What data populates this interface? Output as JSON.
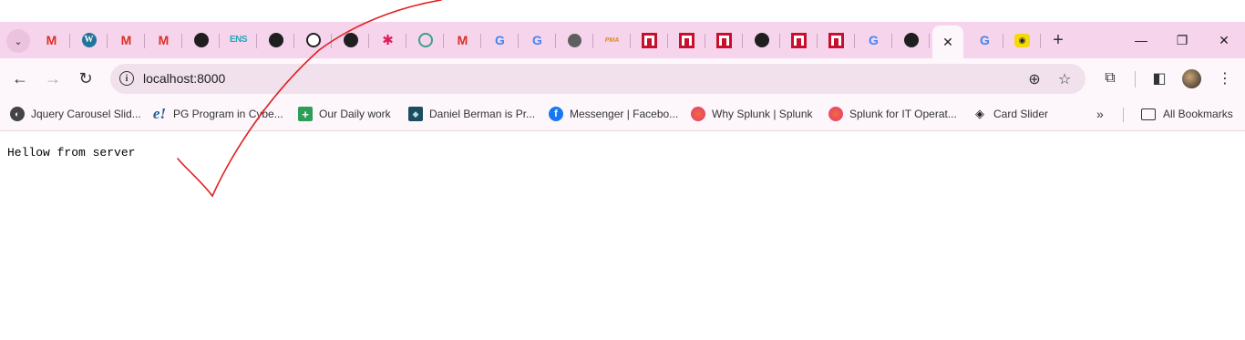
{
  "browser": {
    "tabs": [
      {
        "icon": "gmail-icon",
        "glyph": "M"
      },
      {
        "icon": "wordpress-icon",
        "glyph": "W"
      },
      {
        "icon": "gmail-icon",
        "glyph": "M"
      },
      {
        "icon": "gmail-icon",
        "glyph": "M"
      },
      {
        "icon": "github-icon",
        "glyph": ""
      },
      {
        "icon": "ens-icon",
        "glyph": "ENS"
      },
      {
        "icon": "github-icon",
        "glyph": ""
      },
      {
        "icon": "clock-icon",
        "glyph": ""
      },
      {
        "icon": "github-icon",
        "glyph": ""
      },
      {
        "icon": "slack-icon",
        "glyph": "✱"
      },
      {
        "icon": "chatgpt-icon",
        "glyph": ""
      },
      {
        "icon": "gmail-icon",
        "glyph": "M"
      },
      {
        "icon": "google-icon",
        "glyph": "G"
      },
      {
        "icon": "google-icon",
        "glyph": "G"
      },
      {
        "icon": "globe-icon",
        "glyph": ""
      },
      {
        "icon": "phpmyadmin-icon",
        "glyph": "PMA"
      },
      {
        "icon": "red-square-icon",
        "glyph": ""
      },
      {
        "icon": "red-square-icon",
        "glyph": ""
      },
      {
        "icon": "red-square-icon",
        "glyph": ""
      },
      {
        "icon": "github-icon",
        "glyph": ""
      },
      {
        "icon": "red-square-icon",
        "glyph": ""
      },
      {
        "icon": "red-square-icon",
        "glyph": ""
      },
      {
        "icon": "google-icon",
        "glyph": "G"
      },
      {
        "icon": "github-icon",
        "glyph": ""
      },
      {
        "icon": "close-icon",
        "glyph": "✕",
        "active": true
      },
      {
        "icon": "google-icon",
        "glyph": "G"
      },
      {
        "icon": "yellow-app-icon",
        "glyph": "◉"
      }
    ],
    "new_tab_glyph": "+",
    "window_controls": {
      "minimize": "—",
      "restore": "❐",
      "close": "✕"
    }
  },
  "toolbar": {
    "back_glyph": "←",
    "forward_glyph": "→",
    "reload_glyph": "↻",
    "url": "localhost:8000",
    "info_glyph": "i",
    "zoom_glyph": "⊕",
    "star_glyph": "☆",
    "extensions_glyph": "⧉",
    "sidepanel_glyph": "◧",
    "menu_glyph": "⋮"
  },
  "bookmarks": [
    {
      "label": "Jquery Carousel Slid...",
      "icon": "jquery-icon",
      "glyph": "◐"
    },
    {
      "label": "PG Program in Cybe...",
      "icon": "e-icon",
      "glyph": "e!"
    },
    {
      "label": "Our Daily work",
      "icon": "plus-icon",
      "glyph": "+"
    },
    {
      "label": "Daniel Berman is Pr...",
      "icon": "db-icon",
      "glyph": "◆"
    },
    {
      "label": "Messenger | Facebo...",
      "icon": "facebook-icon",
      "glyph": "f"
    },
    {
      "label": "Why Splunk | Splunk",
      "icon": "splunk-icon",
      "glyph": ""
    },
    {
      "label": "Splunk for IT Operat...",
      "icon": "splunk-icon",
      "glyph": ""
    },
    {
      "label": "Card Slider",
      "icon": "codepen-icon",
      "glyph": "◈"
    }
  ],
  "bookmarks_more_glyph": "»",
  "all_bookmarks_label": "All Bookmarks",
  "page": {
    "text": "Hellow from server"
  },
  "annotation": {
    "color": "#e02020"
  }
}
